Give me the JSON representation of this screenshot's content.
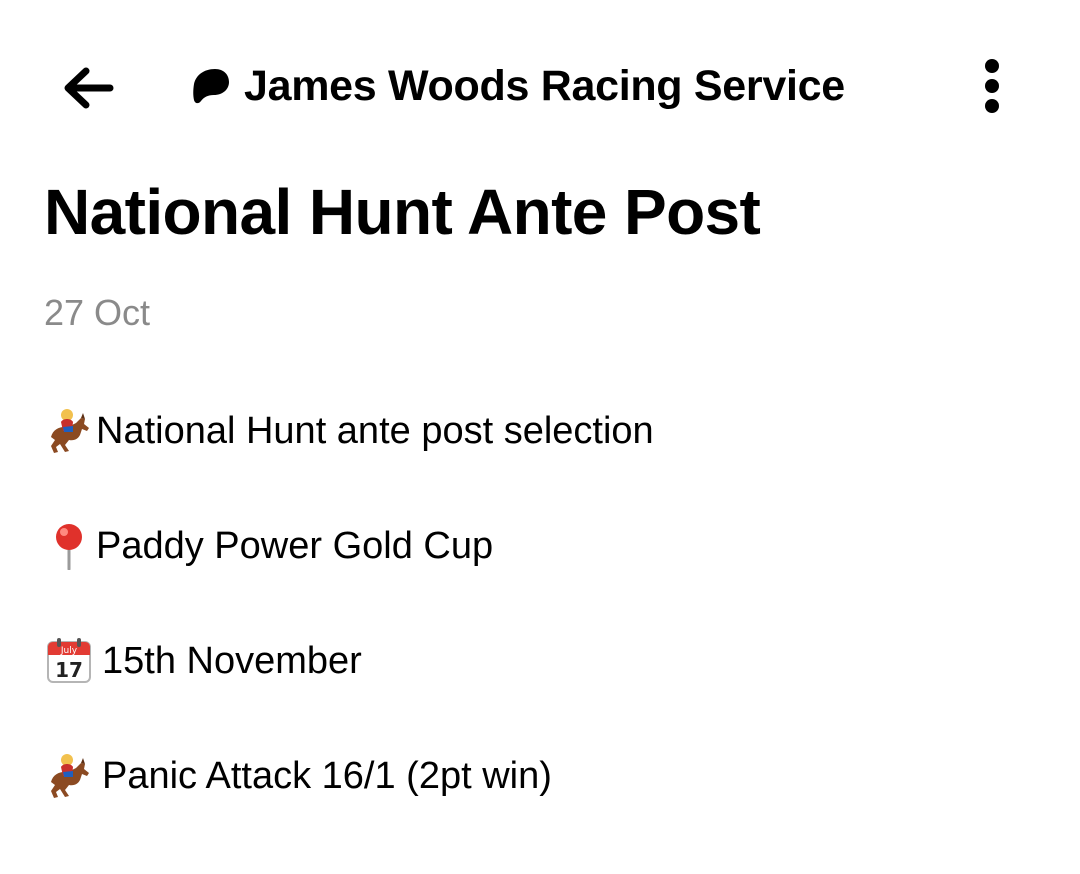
{
  "header": {
    "back_icon": "arrow-left-icon",
    "creator_logo_icon": "patreon-logo-icon",
    "creator_name": "James Woods Racing Service",
    "more_icon": "vertical-ellipsis-icon"
  },
  "post": {
    "title": "National Hunt Ante Post",
    "date": "27 Oct",
    "lines": [
      {
        "icon": "horse-racing-icon",
        "text": "National Hunt ante post selection"
      },
      {
        "icon": "round-pushpin-icon",
        "text": "Paddy Power Gold Cup"
      },
      {
        "icon": "calendar-icon",
        "text": "15th November",
        "icon_month": "July",
        "icon_day": "17"
      },
      {
        "icon": "horse-racing-icon",
        "text": "Panic Attack 16/1 (2pt win)"
      }
    ]
  }
}
